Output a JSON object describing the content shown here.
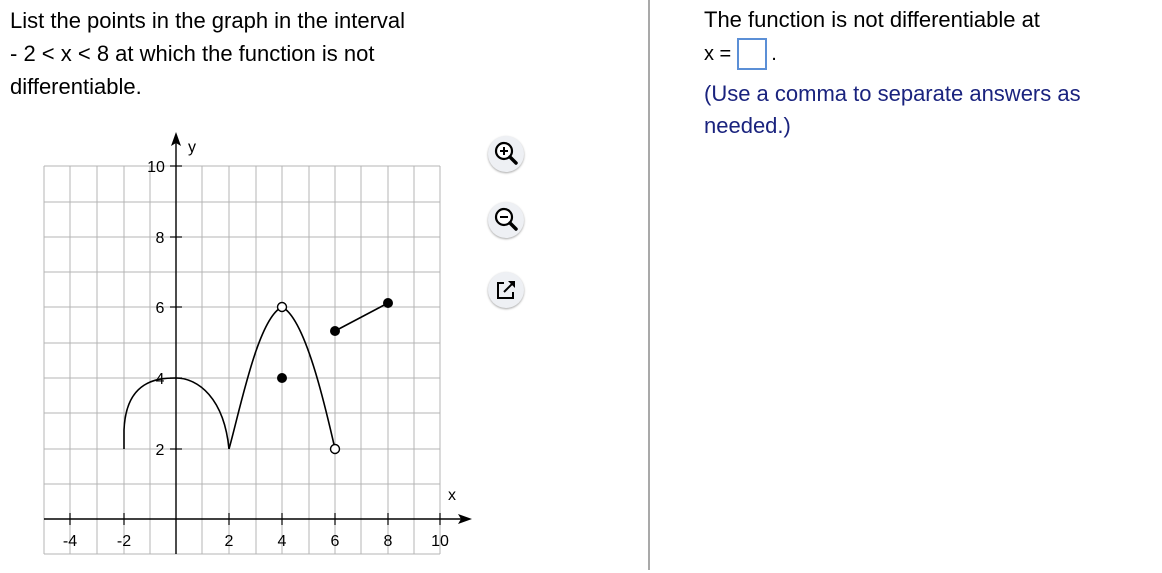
{
  "question": {
    "line1": "List the points in the graph in the interval",
    "line2": "- 2 < x < 8 at which the function is not",
    "line3": "differentiable."
  },
  "graph": {
    "x_label": "x",
    "y_label": "y",
    "x_tick_labels": [
      "-4",
      "-2",
      "2",
      "4",
      "6",
      "8",
      "10"
    ],
    "y_tick_labels": [
      "2",
      "4",
      "6",
      "8",
      "10"
    ]
  },
  "tools": {
    "zoom_in_icon": "zoom-in-icon",
    "zoom_out_icon": "zoom-out-icon",
    "popout_icon": "external-window-icon"
  },
  "answer": {
    "prompt": "The function is not differentiable at",
    "x_equals": "x =",
    "period": ".",
    "input_value": "",
    "hint": "(Use a comma to separate answers as needed.)"
  },
  "colors": {
    "hint_text": "#1a237e",
    "input_border": "#5b8fd6",
    "grid": "#b4b4b4",
    "divider": "#a9a9a9"
  }
}
